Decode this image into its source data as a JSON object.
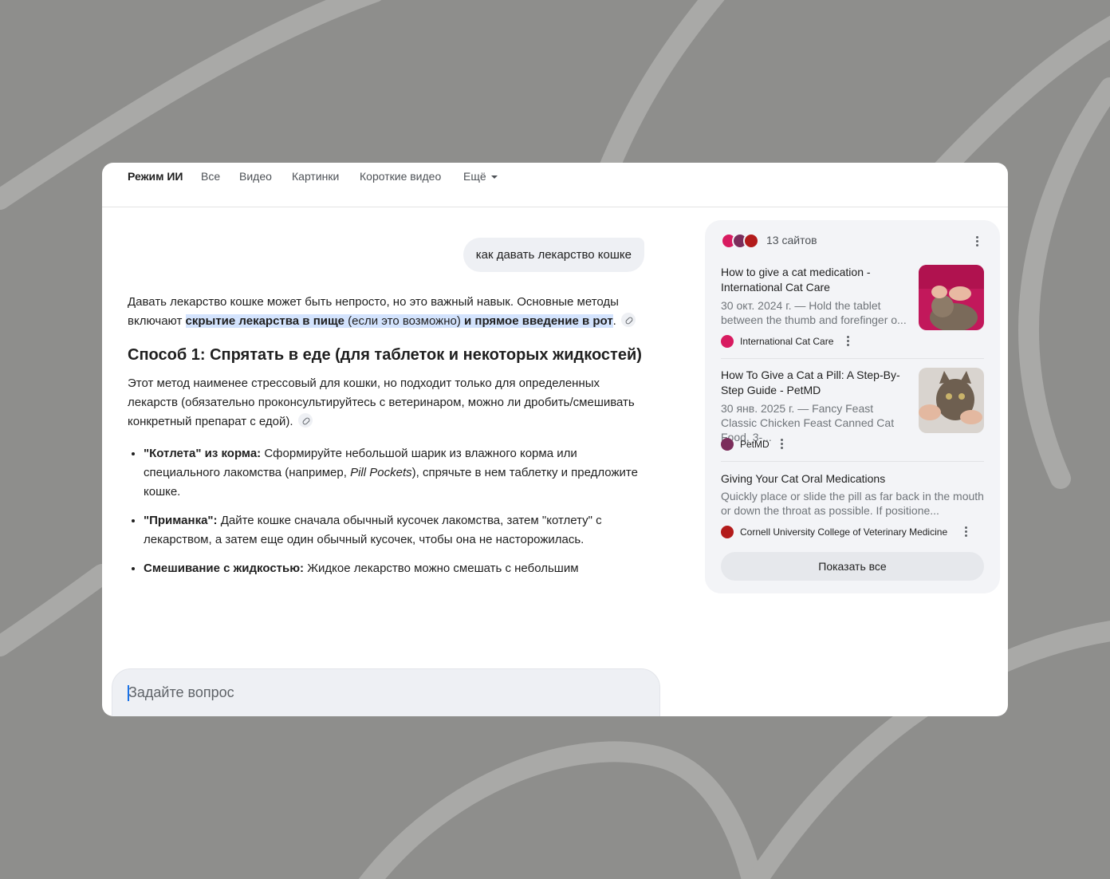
{
  "nav": {
    "tabs": [
      {
        "label": "Режим ИИ"
      },
      {
        "label": "Все"
      },
      {
        "label": "Видео"
      },
      {
        "label": "Картинки"
      },
      {
        "label": "Короткие видео"
      },
      {
        "label": "Ещё"
      }
    ]
  },
  "query": "как давать лекарство кошке",
  "answer": {
    "intro_a": "Давать лекарство кошке может быть непросто, но это важный навык. Основные методы включают ",
    "intro_hl_1": "скрытие лекарства в пище ",
    "intro_hl_2": "(если это возможно)",
    "intro_hl_3": " и прямое введение в рот",
    "intro_end": ".",
    "method1_heading": "Способ 1: Спрятать в еде (для таблеток и некоторых жидкостей)",
    "method1_body": "Этот метод наименее стрессовый для кошки, но подходит только для определенных лекарств (обязательно проконсультируйтесь с ветеринаром, можно ли дробить/смешивать конкретный препарат с едой).",
    "bullets": [
      {
        "bold": "\"Котлета\" из корма:",
        "text_a": " Сформируйте небольшой шарик из влажного корма или специального лакомства (например, ",
        "italic": "Pill Pockets",
        "text_b": "), спрячьте в нем таблетку и предложите кошке."
      },
      {
        "bold": "\"Приманка\":",
        "text_a": " Дайте кошке сначала обычный кусочек лакомства, затем \"котлету\" с лекарством, а затем еще один обычный кусочек, чтобы она не насторожилась.",
        "italic": "",
        "text_b": ""
      },
      {
        "bold": "Смешивание с жидкостью:",
        "text_a": " Жидкое лекарство можно смешать с небольшим",
        "italic": "",
        "text_b": ""
      }
    ]
  },
  "composer": {
    "placeholder": "Задайте вопрос",
    "icons": {
      "add": "plus-icon",
      "voice": "mic-icon"
    }
  },
  "sources": {
    "count_label": "13 сайтов",
    "items": [
      {
        "title": "How to give a cat medication - International Cat Care",
        "snippet": "30 окт. 2024 г. — Hold the tablet between the thumb and forefinger o...",
        "site": "International Cat Care",
        "fav_color": "#d81b60"
      },
      {
        "title": "How To Give a Cat a Pill: A Step-By-Step Guide - PetMD",
        "snippet": "30 янв. 2025 г. — Fancy Feast Classic Chicken Feast Canned Cat Food, 3-...",
        "site": "PetMD",
        "fav_color": "#7b2d5b"
      },
      {
        "title": "Giving Your Cat Oral Medications",
        "snippet": "Quickly place or slide the pill as far back in the mouth or down the throat as possible. If positione...",
        "site": "Cornell University College of Veterinary Medicine",
        "fav_color": "#b31b1b"
      }
    ],
    "show_all": "Показать все"
  },
  "colors": {
    "background": "#8e8e8c",
    "highlight": "#d3e3fd",
    "panel": "#f3f4f7"
  }
}
